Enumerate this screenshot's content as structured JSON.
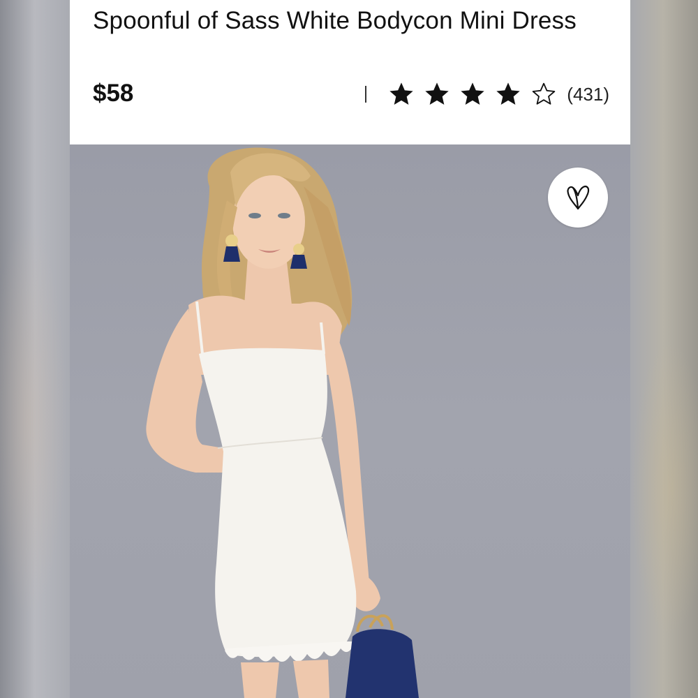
{
  "product": {
    "title": "Spoonful of Sass White Bodycon Mini Dress",
    "price": "$58",
    "rating_value": 4,
    "rating_max": 5,
    "review_count": "(431)"
  },
  "icons": {
    "favorite": "heart-outline-icon",
    "star_filled": "star-filled-icon",
    "star_empty": "star-outline-icon"
  },
  "colors": {
    "text": "#111111",
    "photo_background": "#a0a2ac",
    "dress": "#f5f3ee"
  }
}
